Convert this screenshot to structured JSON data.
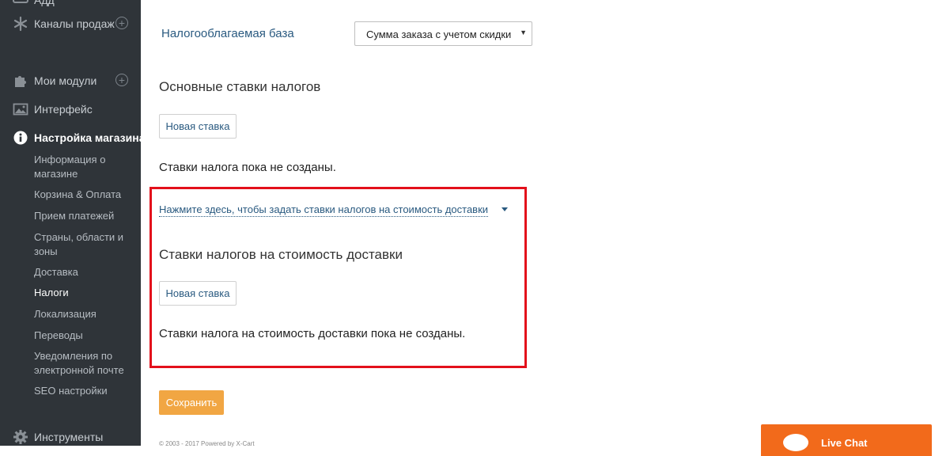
{
  "sidebar": {
    "top_partial_label": "Адд",
    "sales_channels": "Каналы продаж",
    "my_modules": "Мои модули",
    "interface": "Интерфейс",
    "store_settings": "Настройка магазина",
    "sub_items": [
      "Информация о магазине",
      "Корзина & Оплата",
      "Прием платежей",
      "Страны, области и зоны",
      "Доставка",
      "Налоги",
      "Локализация",
      "Переводы",
      "Уведомления по электронной почте",
      "SEO настройки"
    ],
    "tools": "Инструменты",
    "plus_symbol": "+"
  },
  "main": {
    "tax_base_label": "Налогооблагаемая база",
    "tax_base_value": "Сумма заказа с учетом скидки",
    "main_rates_heading": "Основные ставки налогов",
    "new_rate_button": "Новая ставка",
    "no_rates_text": "Ставки налога пока не созданы.",
    "shipping_toggle_link": "Нажмите здесь, чтобы задать ставки налогов на стоимость доставки",
    "shipping_rates_heading": "Ставки налогов на стоимость доставки",
    "shipping_new_rate_button": "Новая ставка",
    "no_shipping_rates_text": "Ставки налога на стоимость доставки пока не созданы.",
    "save_button": "Сохранить",
    "footer_text": "© 2003 - 2017 Powered by X-Cart"
  },
  "live_chat": {
    "label": "Live Chat"
  },
  "colors": {
    "sidebar_bg": "#2f3439",
    "link": "#2a5a80",
    "save_button": "#f1a643",
    "highlight_border": "#e3101b",
    "live_chat": "#f26a1b"
  }
}
